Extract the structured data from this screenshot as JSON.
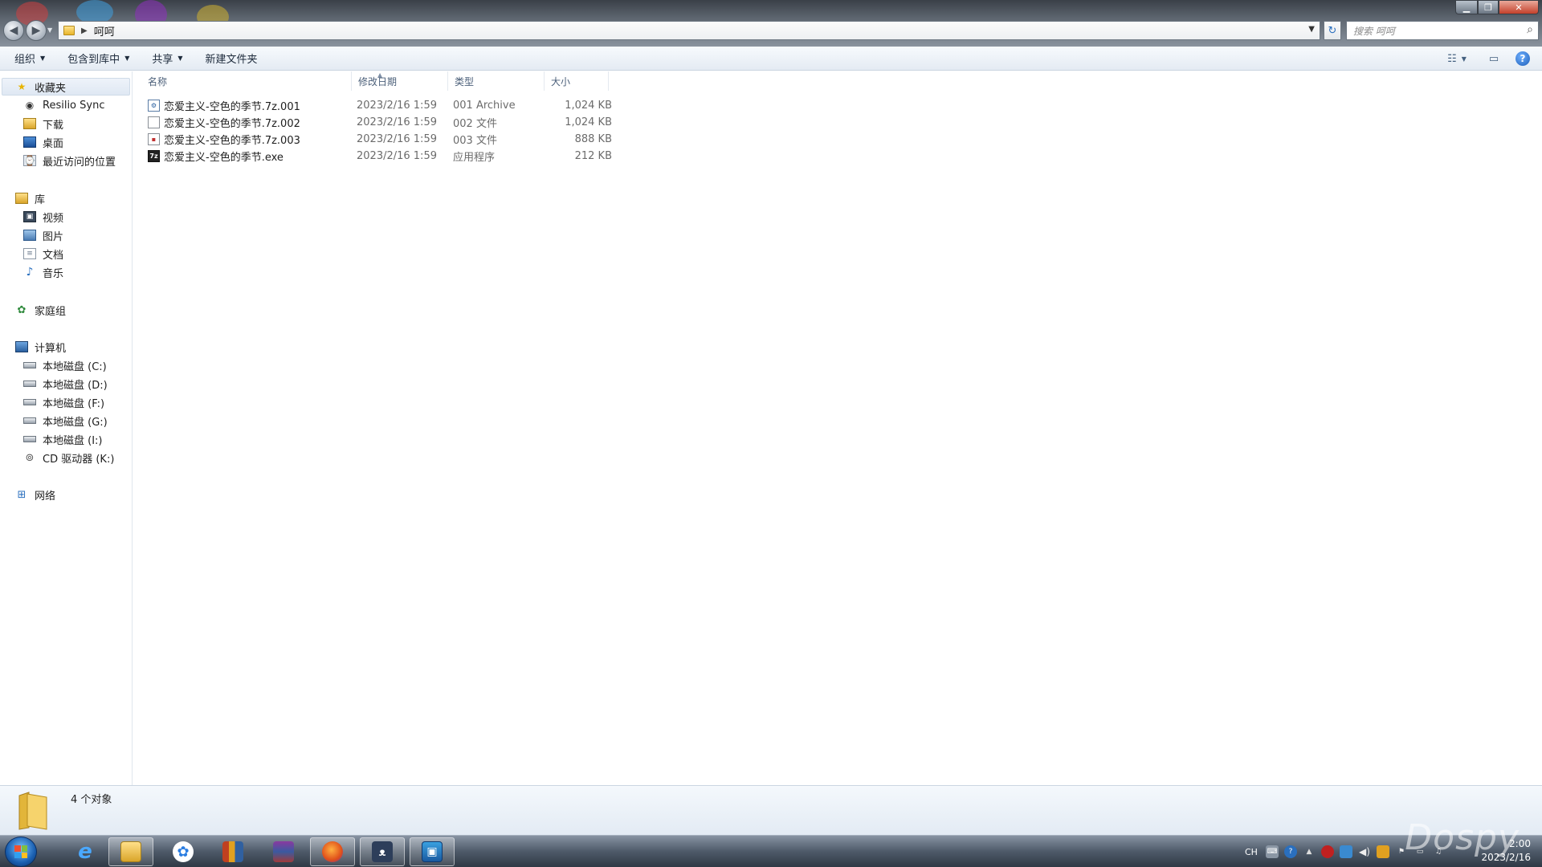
{
  "window": {
    "address": {
      "crumb": "呵呵"
    },
    "search_placeholder": "搜索 呵呵"
  },
  "toolbar": {
    "organize": "组织",
    "include_library": "包含到库中",
    "share": "共享",
    "new_folder": "新建文件夹"
  },
  "sidebar": {
    "favorites": {
      "label": "收藏夹",
      "items": [
        "Resilio Sync",
        "下载",
        "桌面",
        "最近访问的位置"
      ]
    },
    "libraries": {
      "label": "库",
      "items": [
        "视频",
        "图片",
        "文档",
        "音乐"
      ]
    },
    "homegroup": "家庭组",
    "computer": {
      "label": "计算机",
      "items": [
        "本地磁盘 (C:)",
        "本地磁盘 (D:)",
        "本地磁盘 (F:)",
        "本地磁盘  (G:)",
        "本地磁盘 (I:)",
        "CD 驱动器 (K:)"
      ]
    },
    "network": "网络"
  },
  "columns": {
    "name": "名称",
    "date": "修改日期",
    "type": "类型",
    "size": "大小"
  },
  "files": [
    {
      "name": "恋爱主义-空色的季节.7z.001",
      "date": "2023/2/16 1:59",
      "type": "001 Archive",
      "size": "1,024 KB",
      "icon": "archive-file-icon"
    },
    {
      "name": "恋爱主义-空色的季节.7z.002",
      "date": "2023/2/16 1:59",
      "type": "002 文件",
      "size": "1,024 KB",
      "icon": "blank-file-icon"
    },
    {
      "name": "恋爱主义-空色的季节.7z.003",
      "date": "2023/2/16 1:59",
      "type": "003 文件",
      "size": "888 KB",
      "icon": "blank-file-icon"
    },
    {
      "name": "恋爱主义-空色的季节.exe",
      "date": "2023/2/16 1:59",
      "type": "应用程序",
      "size": "212 KB",
      "icon": "7z-exe-icon"
    }
  ],
  "status": {
    "count_text": "4 个对象"
  },
  "taskbar": {
    "tray_lang": "CH",
    "clock_time": "2:00",
    "clock_date": "2023/2/16"
  },
  "watermark": "Dospy"
}
